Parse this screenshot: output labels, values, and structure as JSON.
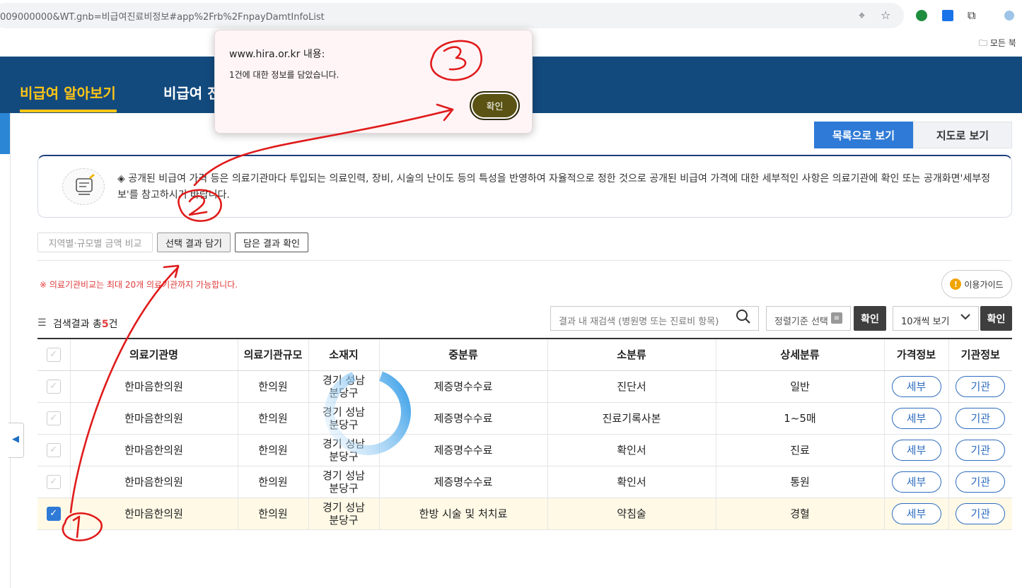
{
  "browser": {
    "url": "009000000&WT.gnb=비급여진료비정보#app%2Frb%2FnpayDamtInfoList",
    "bookmarks_label": "모든 북"
  },
  "gnb": {
    "items": [
      "비급여 알아보기",
      "비급여 진"
    ]
  },
  "view_toggle": {
    "list": "목록으로 보기",
    "map": "지도로 보기"
  },
  "notice": "◈ 공개된 비급여 가격 등은 의료기관마다 투입되는 의료인력, 장비, 시술의 난이도 등의 특성을 반영하여 자율적으로 정한 것으로 공개된 비급여 가격에 대한 세부적인 사항은 의료기관에 확인 또는 공개화면'세부정보'를 참고하시기 바랍니다.",
  "actions": {
    "compare": "지역별·규모별 금액 비교",
    "save": "선택 결과 담기",
    "check": "담은 결과 확인"
  },
  "warning": "※ 의료기관비교는 최대 20개 의료기관까지 가능합니다.",
  "guide": {
    "label": "이용가이드",
    "icon_text": "!"
  },
  "results": {
    "prefix": "검색결과 총",
    "count": "5",
    "suffix": "건",
    "search_placeholder": "결과 내 재검색 (병원명 또는 진료비 항목)",
    "sort_label": "정렬기준 선택",
    "sort_ok": "확인",
    "page_size": "10개씩 보기",
    "page_ok": "확인"
  },
  "table": {
    "headers": [
      "",
      "의료기관명",
      "의료기관규모",
      "소재지",
      "중분류",
      "소분류",
      "상세분류",
      "가격정보",
      "기관정보"
    ],
    "rows": [
      {
        "checked": false,
        "name": "한마음한의원",
        "size": "한의원",
        "location": "경기 성남분당구",
        "mid": "제증명수수료",
        "sub": "진단서",
        "detail": "일반",
        "price_btn": "세부",
        "org_btn": "기관"
      },
      {
        "checked": false,
        "name": "한마음한의원",
        "size": "한의원",
        "location": "경기 성남분당구",
        "mid": "제증명수수료",
        "sub": "진료기록사본",
        "detail": "1~5매",
        "price_btn": "세부",
        "org_btn": "기관"
      },
      {
        "checked": false,
        "name": "한마음한의원",
        "size": "한의원",
        "location": "경기 성남분당구",
        "mid": "제증명수수료",
        "sub": "확인서",
        "detail": "진료",
        "price_btn": "세부",
        "org_btn": "기관"
      },
      {
        "checked": false,
        "name": "한마음한의원",
        "size": "한의원",
        "location": "경기 성남분당구",
        "mid": "제증명수수료",
        "sub": "확인서",
        "detail": "통원",
        "price_btn": "세부",
        "org_btn": "기관"
      },
      {
        "checked": true,
        "name": "한마음한의원",
        "size": "한의원",
        "location": "경기 성남분당구",
        "mid": "한방 시술 및 처치료",
        "sub": "약침술",
        "detail": "경혈",
        "price_btn": "세부",
        "org_btn": "기관"
      }
    ]
  },
  "dialog": {
    "title": "www.hira.or.kr 내용:",
    "message": "1건에 대한 정보를 담았습니다.",
    "ok": "확인"
  },
  "annotations": {
    "color": "#e01b1b"
  },
  "colors": {
    "gnb_bg": "#134a7e",
    "gnb_active": "#ffc515",
    "primary": "#2e7ad6"
  }
}
